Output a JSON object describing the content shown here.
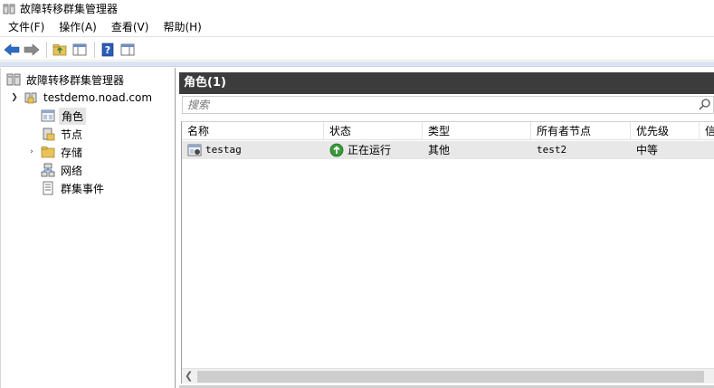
{
  "window": {
    "title": "故障转移群集管理器"
  },
  "menu": [
    {
      "label": "文件(F)"
    },
    {
      "label": "操作(A)"
    },
    {
      "label": "查看(V)"
    },
    {
      "label": "帮助(H)"
    }
  ],
  "tree": {
    "root": "故障转移群集管理器",
    "cluster": "testdemo.noad.com",
    "items": [
      {
        "label": "角色",
        "icon": "roles-icon",
        "selected": true
      },
      {
        "label": "节点",
        "icon": "nodes-icon"
      },
      {
        "label": "存储",
        "icon": "storage-icon",
        "expandable": true
      },
      {
        "label": "网络",
        "icon": "network-icon"
      },
      {
        "label": "群集事件",
        "icon": "cluster-events-icon"
      }
    ]
  },
  "pane": {
    "header": "角色(1)",
    "search_placeholder": "搜索",
    "columns": [
      "名称",
      "状态",
      "类型",
      "所有者节点",
      "优先级",
      "信"
    ],
    "rows": [
      {
        "name": "testag",
        "status": "正在运行",
        "type": "其他",
        "owner": "test2",
        "priority": "中等"
      }
    ]
  },
  "colors": {
    "header_bg": "#3c3c3c",
    "status_running": "#3a9a3a",
    "accent_blue": "#2a6cc4"
  }
}
